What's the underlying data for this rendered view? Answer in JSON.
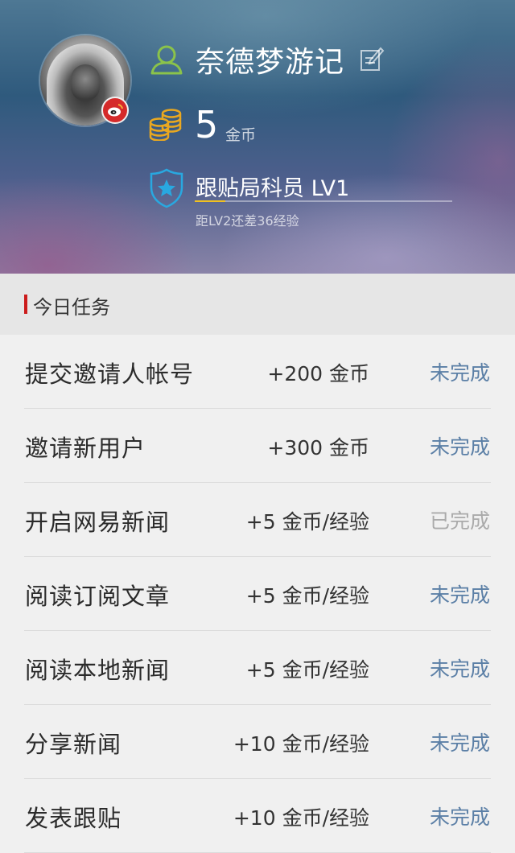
{
  "profile": {
    "username": "奈德梦游记",
    "coins": "5",
    "coins_unit": "金币",
    "level_text": "跟贴局科员 LV1",
    "level_hint": "距LV2还差36经验",
    "level_progress": 0.12
  },
  "section": {
    "title": "今日任务"
  },
  "colors": {
    "status_pending": "#5b7fa6",
    "status_done": "#aaaaaa",
    "accent_red": "#cc1c1c",
    "level_fill": "#f0c020"
  },
  "tasks": [
    {
      "name": "提交邀请人帐号",
      "reward": "+200 金币",
      "status": "未完成",
      "done": false
    },
    {
      "name": "邀请新用户",
      "reward": "+300 金币",
      "status": "未完成",
      "done": false
    },
    {
      "name": "开启网易新闻",
      "reward": "+5 金币/经验",
      "status": "已完成",
      "done": true
    },
    {
      "name": "阅读订阅文章",
      "reward": "+5 金币/经验",
      "status": "未完成",
      "done": false
    },
    {
      "name": "阅读本地新闻",
      "reward": "+5 金币/经验",
      "status": "未完成",
      "done": false
    },
    {
      "name": "分享新闻",
      "reward": "+10 金币/经验",
      "status": "未完成",
      "done": false
    },
    {
      "name": "发表跟贴",
      "reward": "+10 金币/经验",
      "status": "未完成",
      "done": false
    }
  ]
}
